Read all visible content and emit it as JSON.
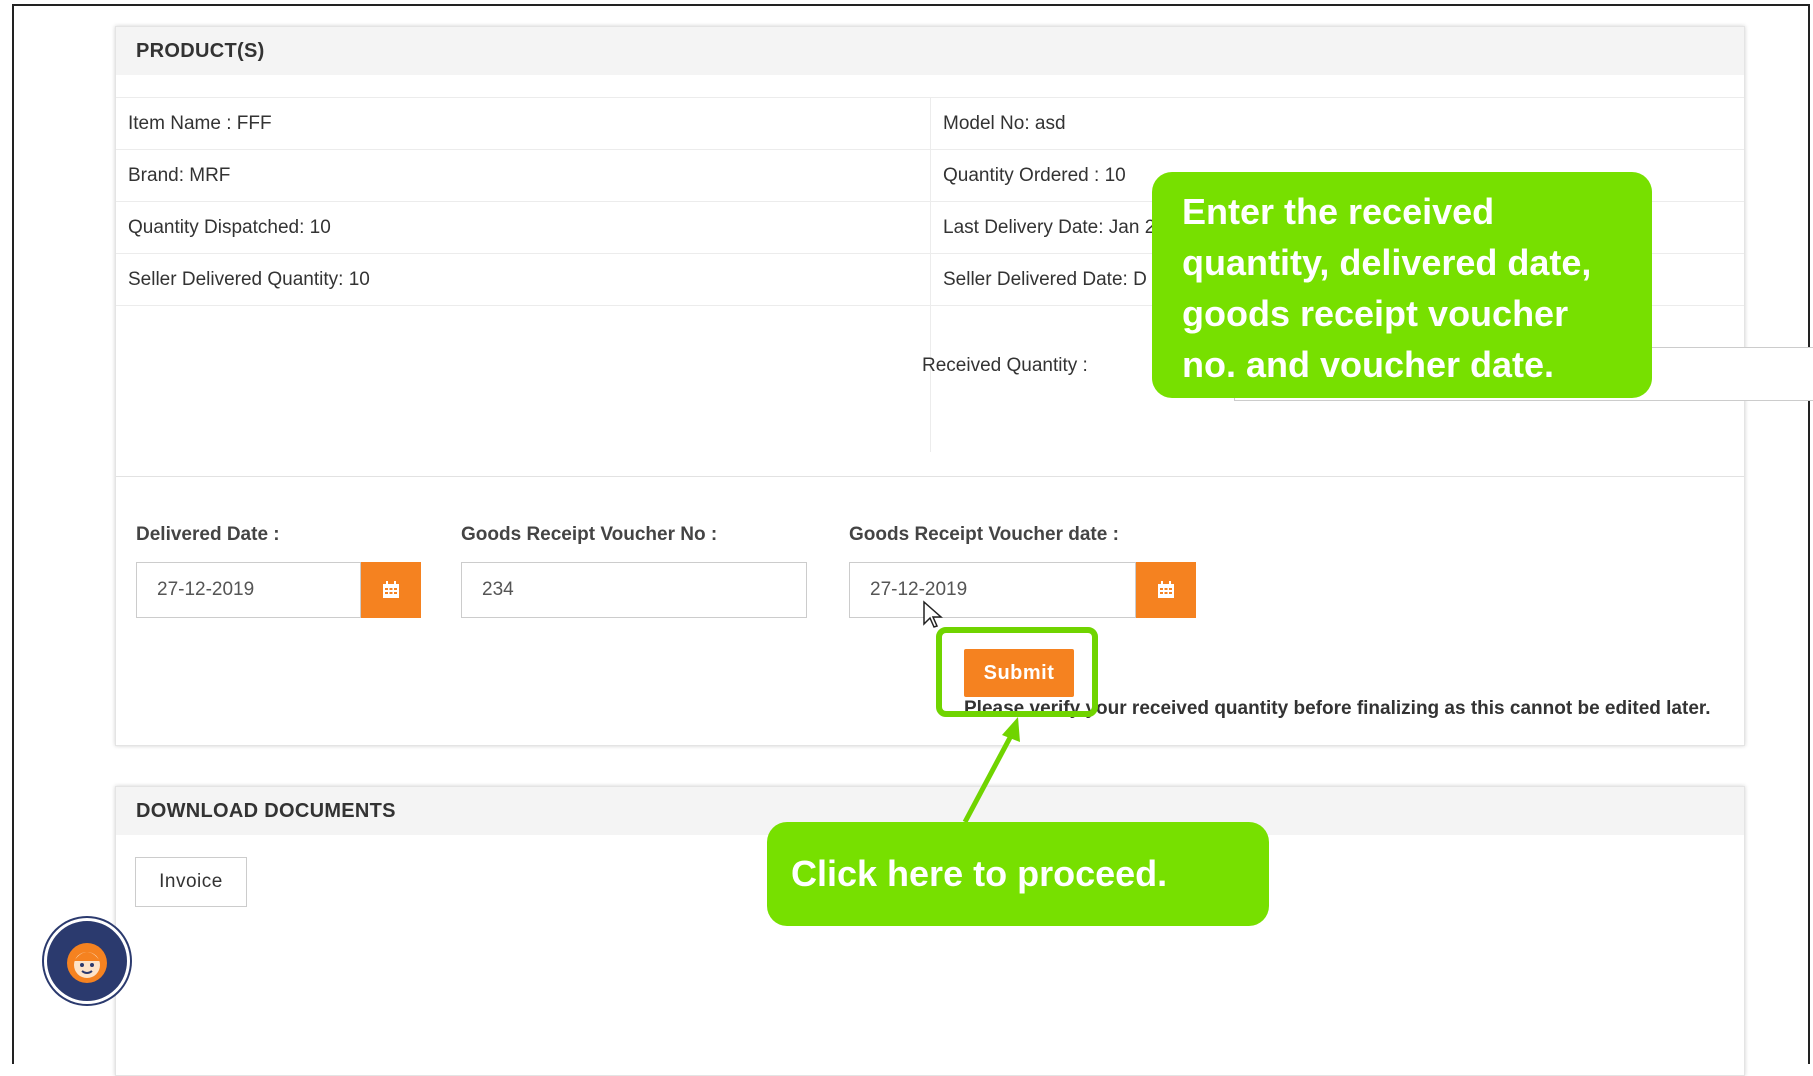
{
  "products": {
    "header": "PRODUCT(S)",
    "item_name": "Item Name : FFF",
    "model_no": "Model No: asd",
    "brand": "Brand: MRF",
    "qty_ordered": "Quantity Ordered : 10",
    "qty_dispatched": "Quantity Dispatched: 10",
    "last_delivery": "Last Delivery Date: Jan 2",
    "seller_qty": "Seller Delivered Quantity: 10",
    "seller_date": "Seller Delivered Date: D",
    "received_qty_label": "Received Quantity :"
  },
  "form": {
    "delivered_label": "Delivered Date :",
    "delivered_value": "27-12-2019",
    "voucher_no_label": "Goods Receipt Voucher No :",
    "voucher_no_value": "234",
    "voucher_date_label": "Goods Receipt Voucher date :",
    "voucher_date_value": "27-12-2019",
    "submit": "Submit",
    "verify_text": "Please verify your received quantity before finalizing as this cannot be edited later."
  },
  "downloads": {
    "header": "DOWNLOAD DOCUMENTS",
    "invoice": "Invoice"
  },
  "callouts": {
    "enter": "Enter the received quantity, delivered date, goods receipt voucher no. and voucher date.",
    "click": "Click here to proceed."
  },
  "colors": {
    "accent": "#f58220",
    "callout": "#77e000"
  },
  "icons": {
    "calendar": "calendar-icon",
    "cursor": "mouse-cursor-icon",
    "chat": "chat-support-icon"
  }
}
